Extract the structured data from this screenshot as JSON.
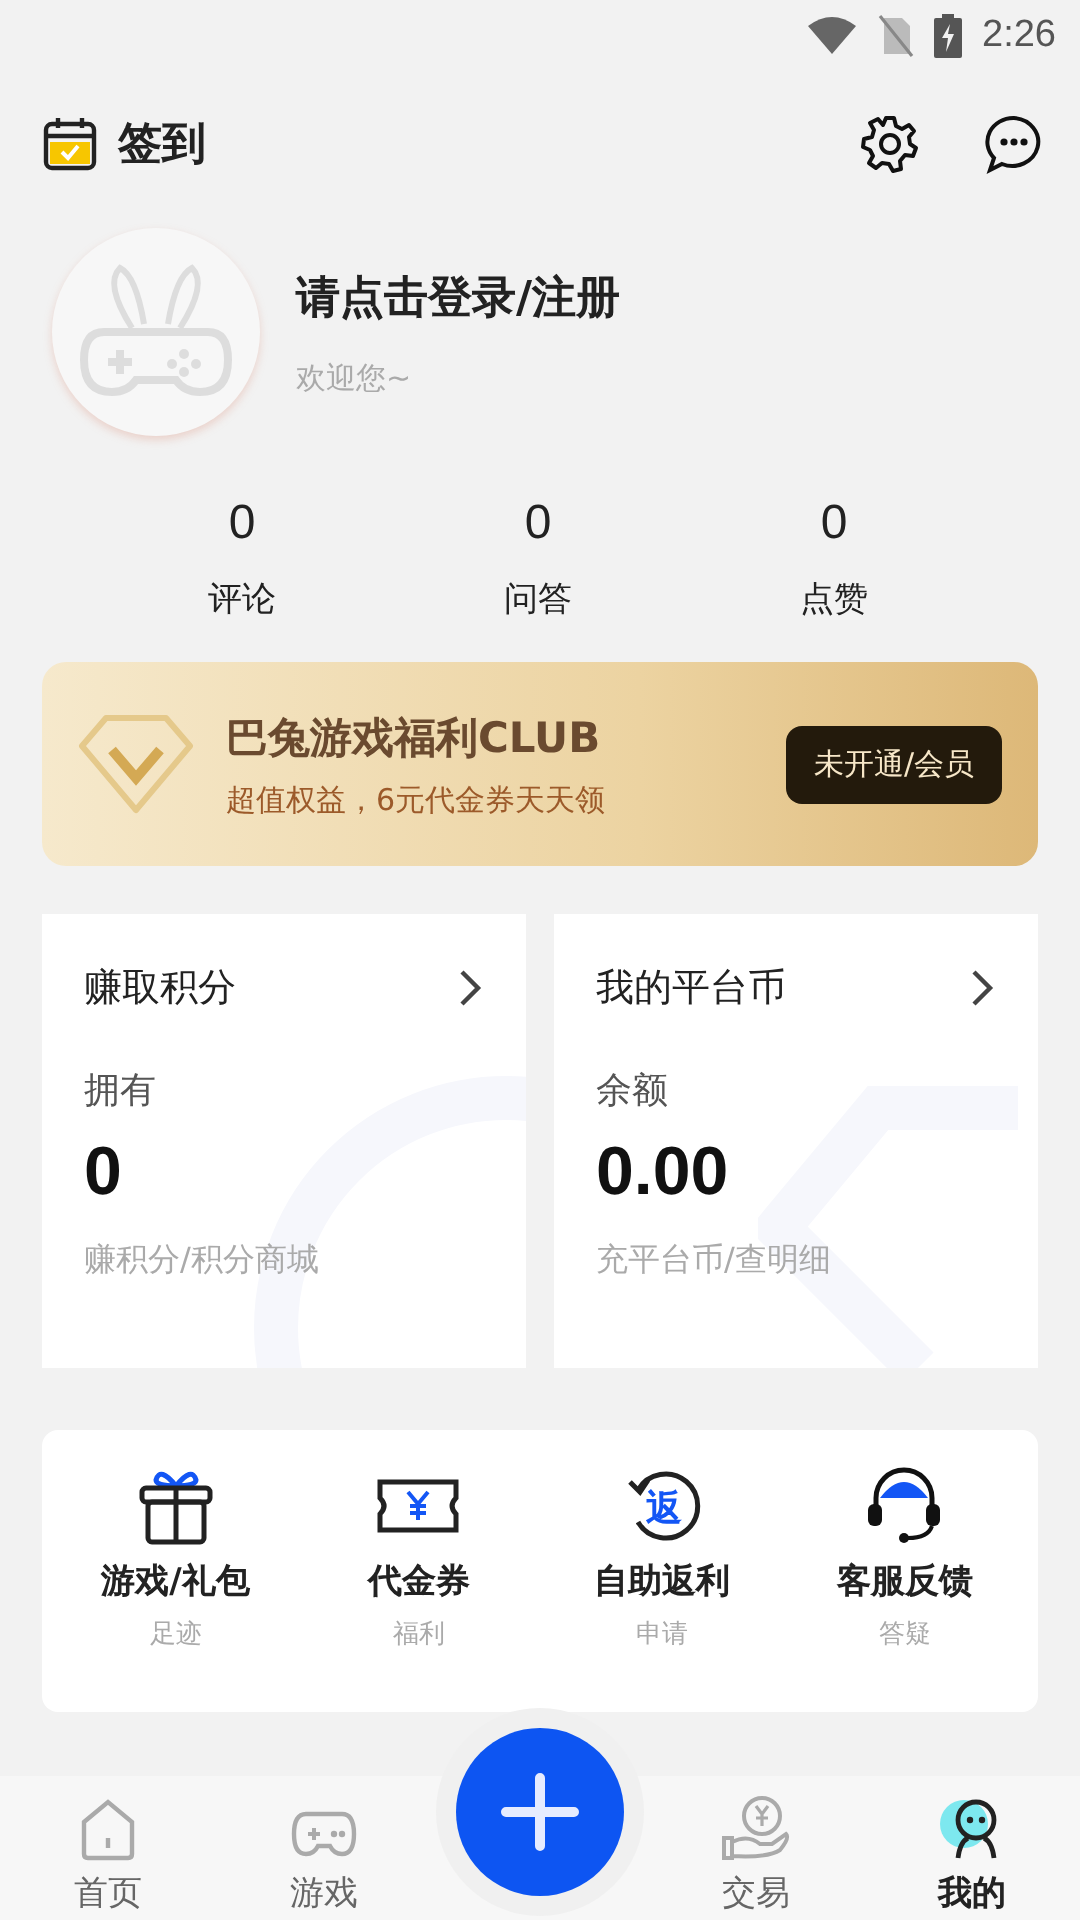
{
  "status_bar": {
    "time": "2:26"
  },
  "header": {
    "title": "签到"
  },
  "profile": {
    "name": "请点击登录/注册",
    "subtitle": "欢迎您~"
  },
  "stats": [
    {
      "value": "0",
      "label": "评论"
    },
    {
      "value": "0",
      "label": "问答"
    },
    {
      "value": "0",
      "label": "点赞"
    }
  ],
  "club_banner": {
    "title": "巴兔游戏福利CLUB",
    "subtitle": "超值权益，6元代金券天天领",
    "button": "未开通/会员"
  },
  "cards": [
    {
      "title": "赚取积分",
      "label": "拥有",
      "value": "0",
      "link": "赚积分/积分商城"
    },
    {
      "title": "我的平台币",
      "label": "余额",
      "value": "0.00",
      "link": "充平台币/查明细"
    }
  ],
  "shortcuts": [
    {
      "kind": "gift",
      "title": "游戏/礼包",
      "subtitle": "足迹"
    },
    {
      "kind": "voucher",
      "title": "代金券",
      "subtitle": "福利"
    },
    {
      "kind": "rebate",
      "title": "自助返利",
      "subtitle": "申请",
      "icon_glyph": "返"
    },
    {
      "kind": "service",
      "title": "客服反馈",
      "subtitle": "答疑"
    }
  ],
  "tabs": [
    {
      "kind": "home",
      "label": "首页",
      "selected": false
    },
    {
      "kind": "games",
      "label": "游戏",
      "selected": false
    },
    {
      "kind": "add"
    },
    {
      "kind": "trade",
      "label": "交易",
      "selected": false
    },
    {
      "kind": "mine",
      "label": "我的",
      "selected": true
    }
  ]
}
